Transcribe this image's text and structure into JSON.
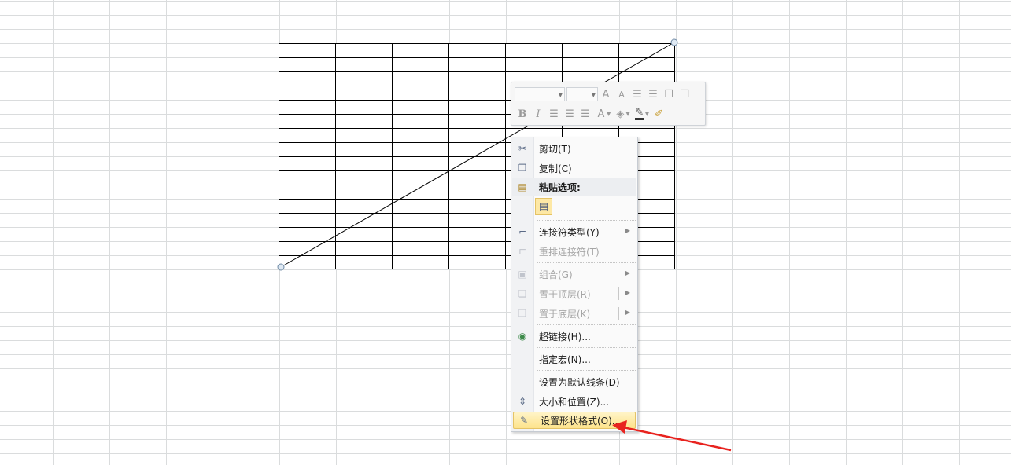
{
  "mini_toolbar": {
    "font_name": "",
    "font_size": "",
    "grow_font_icon": "A",
    "shrink_font_icon": "A",
    "bold": "B",
    "italic": "I",
    "font_color_icon": "A"
  },
  "context_menu": {
    "items": [
      {
        "label": "剪切(T)",
        "icon": "scissors-icon",
        "glyph": "✂",
        "enabled": true
      },
      {
        "label": "复制(C)",
        "icon": "copy-icon",
        "glyph": "❐",
        "enabled": true
      },
      {
        "label": "粘贴选项:",
        "icon": "paste-icon",
        "glyph": "📋",
        "enabled": true,
        "header": true
      },
      {
        "label": "连接符类型(Y)",
        "icon": "connector-icon",
        "glyph": "⌐",
        "enabled": true,
        "submenu": true
      },
      {
        "label": "重排连接符(T)",
        "icon": "reroute-icon",
        "glyph": "⊏",
        "enabled": false
      },
      {
        "label": "组合(G)",
        "icon": "group-icon",
        "glyph": "▣",
        "enabled": false,
        "submenu": true
      },
      {
        "label": "置于顶层(R)",
        "icon": "bring-front-icon",
        "glyph": "❏",
        "enabled": false,
        "submenu": true
      },
      {
        "label": "置于底层(K)",
        "icon": "send-back-icon",
        "glyph": "❏",
        "enabled": false,
        "submenu": true
      },
      {
        "label": "超链接(H)...",
        "icon": "hyperlink-icon",
        "glyph": "🌐",
        "enabled": true
      },
      {
        "label": "指定宏(N)...",
        "icon": "",
        "glyph": "",
        "enabled": true
      },
      {
        "label": "设置为默认线条(D)",
        "icon": "",
        "glyph": "",
        "enabled": true
      },
      {
        "label": "大小和位置(Z)...",
        "icon": "size-position-icon",
        "glyph": "⇕",
        "enabled": true
      },
      {
        "label": "设置形状格式(O)...",
        "icon": "format-shape-icon",
        "glyph": "✎",
        "enabled": true,
        "highlighted": true
      }
    ]
  },
  "colors": {
    "annotation_arrow": "#e8231f",
    "grid_line": "#dadcdd",
    "highlight": "#fde38c"
  }
}
